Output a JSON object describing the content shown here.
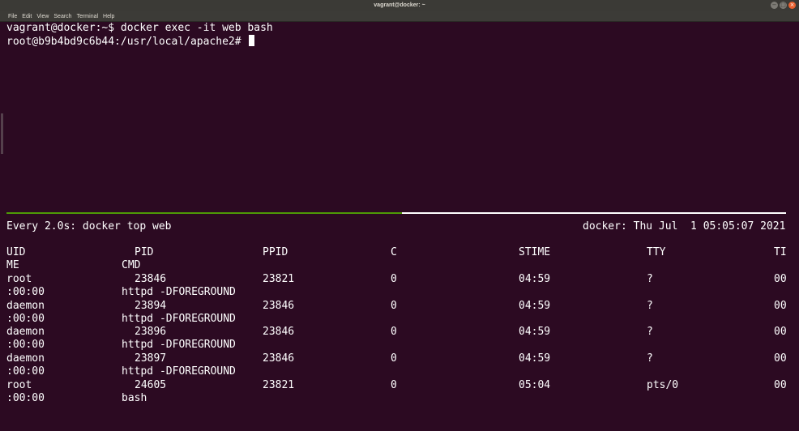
{
  "window": {
    "title": "vagrant@docker: ~"
  },
  "menu": [
    "File",
    "Edit",
    "View",
    "Search",
    "Terminal",
    "Help"
  ],
  "top_pane": {
    "lines": [
      "vagrant@docker:~$ docker exec -it web bash",
      "root@b9b4bd9c6b44:/usr/local/apache2# "
    ]
  },
  "watch": {
    "header_left": "Every 2.0s: docker top web",
    "header_right": "docker: Thu Jul  1 05:05:07 2021"
  },
  "table": {
    "headers": {
      "uid": "UID",
      "pid": "PID",
      "ppid": "PPID",
      "c": "C",
      "stime": "STIME",
      "tty": "TTY",
      "time_start": "TI",
      "time_wrap": "ME",
      "cmd": "CMD"
    },
    "rows": [
      {
        "uid": "root",
        "pid": "23846",
        "ppid": "23821",
        "c": "0",
        "stime": "04:59",
        "tty": "?",
        "time_start": "00",
        "time_wrap": ":00:00",
        "cmd": "httpd -DFOREGROUND"
      },
      {
        "uid": "daemon",
        "pid": "23894",
        "ppid": "23846",
        "c": "0",
        "stime": "04:59",
        "tty": "?",
        "time_start": "00",
        "time_wrap": ":00:00",
        "cmd": "httpd -DFOREGROUND"
      },
      {
        "uid": "daemon",
        "pid": "23896",
        "ppid": "23846",
        "c": "0",
        "stime": "04:59",
        "tty": "?",
        "time_start": "00",
        "time_wrap": ":00:00",
        "cmd": "httpd -DFOREGROUND"
      },
      {
        "uid": "daemon",
        "pid": "23897",
        "ppid": "23846",
        "c": "0",
        "stime": "04:59",
        "tty": "?",
        "time_start": "00",
        "time_wrap": ":00:00",
        "cmd": "httpd -DFOREGROUND"
      },
      {
        "uid": "root",
        "pid": "24605",
        "ppid": "23821",
        "c": "0",
        "stime": "05:04",
        "tty": "pts/0",
        "time_start": "00",
        "time_wrap": ":00:00",
        "cmd": "bash"
      }
    ]
  },
  "colors": {
    "background": "#2c0a22",
    "text": "#ffffff",
    "active_divider": "#4e9a06",
    "titlebar": "#3b3a36"
  }
}
